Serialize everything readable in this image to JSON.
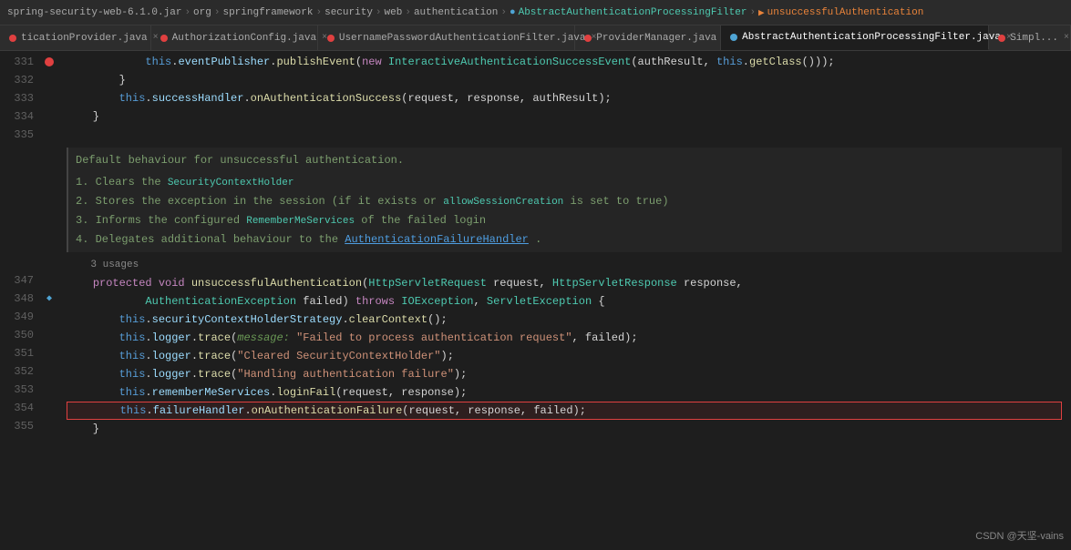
{
  "nav": {
    "items": [
      {
        "label": "spring-security-web-6.1.0.jar",
        "type": "jar"
      },
      {
        "label": "org",
        "type": "pkg"
      },
      {
        "label": "springframework",
        "type": "pkg"
      },
      {
        "label": "security",
        "type": "pkg"
      },
      {
        "label": "web",
        "type": "pkg"
      },
      {
        "label": "authentication",
        "type": "pkg"
      },
      {
        "label": "AbstractAuthenticationProcessingFilter",
        "type": "class"
      },
      {
        "label": "unsuccessfulAuthentication",
        "type": "method"
      }
    ]
  },
  "tabs": [
    {
      "label": "ticationProvider.java",
      "color": "#e04040",
      "active": false
    },
    {
      "label": "AuthorizationConfig.java",
      "color": "#e04040",
      "active": false
    },
    {
      "label": "UsernamePasswordAuthenticationFilter.java",
      "color": "#e04040",
      "active": false
    },
    {
      "label": "ProviderManager.java",
      "color": "#e04040",
      "active": false
    },
    {
      "label": "AbstractAuthenticationProcessingFilter.java",
      "color": "#e04040",
      "active": true
    },
    {
      "label": "Simpl...",
      "color": "#e04040",
      "active": false
    }
  ],
  "lines": [
    {
      "num": 331,
      "gutter": "B",
      "content": "line331"
    },
    {
      "num": 332,
      "gutter": "",
      "content": "line332"
    },
    {
      "num": 333,
      "gutter": "",
      "content": "line333"
    },
    {
      "num": 334,
      "gutter": "",
      "content": "line334"
    },
    {
      "num": 335,
      "gutter": "",
      "content": "line335"
    },
    {
      "num": "",
      "gutter": "",
      "content": "comment"
    },
    {
      "num": 347,
      "gutter": "",
      "content": "line347"
    },
    {
      "num": 348,
      "gutter": "",
      "content": "line348"
    },
    {
      "num": 349,
      "gutter": "",
      "content": "line349"
    },
    {
      "num": 350,
      "gutter": "",
      "content": "line350"
    },
    {
      "num": 351,
      "gutter": "",
      "content": "line351"
    },
    {
      "num": 352,
      "gutter": "",
      "content": "line352"
    },
    {
      "num": 353,
      "gutter": "",
      "content": "line353"
    },
    {
      "num": 354,
      "gutter": "H",
      "content": "line354"
    },
    {
      "num": 355,
      "gutter": "",
      "content": "line355"
    }
  ],
  "watermark": "CSDN @天坚-vains"
}
